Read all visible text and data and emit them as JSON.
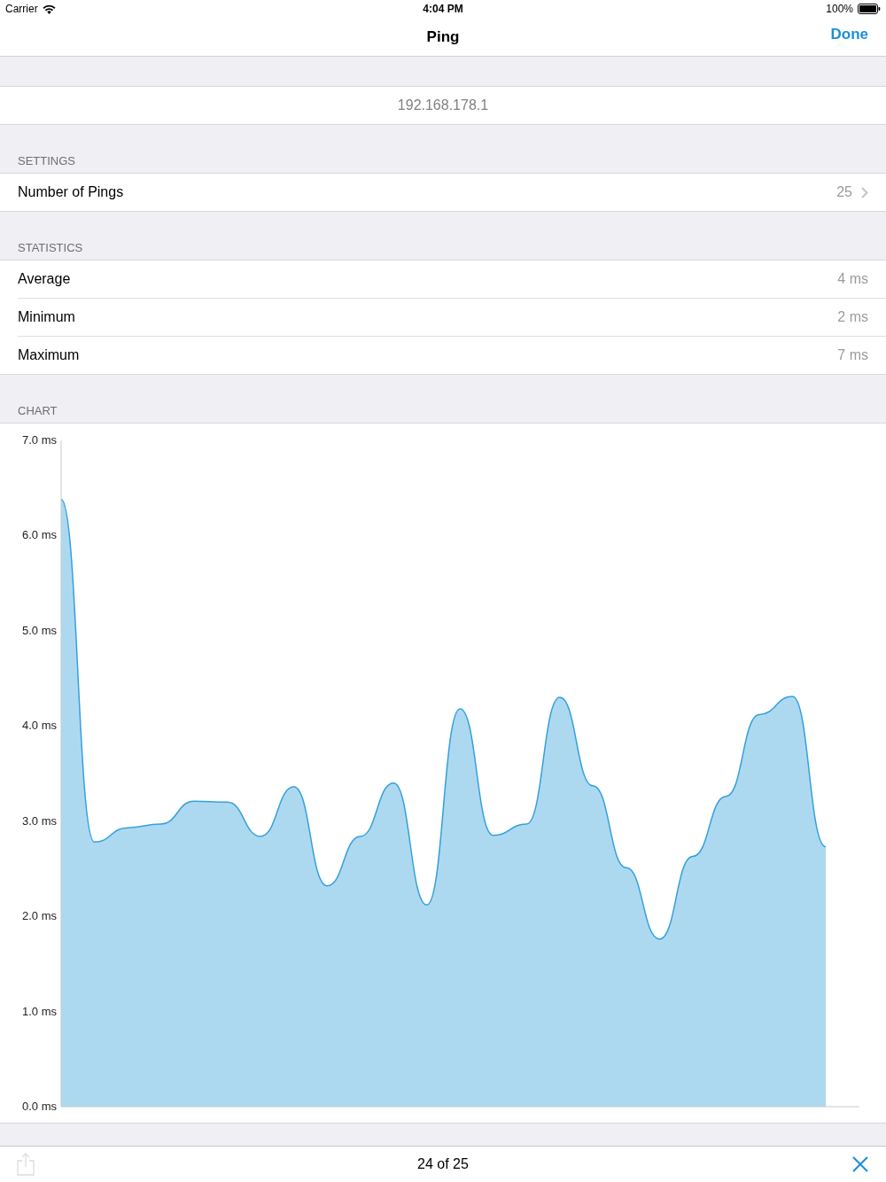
{
  "status_bar": {
    "carrier": "Carrier",
    "time": "4:04 PM",
    "battery": "100%"
  },
  "nav_bar": {
    "title": "Ping",
    "done": "Done"
  },
  "host": {
    "value": "192.168.178.1"
  },
  "sections": [
    {
      "header": "SETTINGS",
      "rows": [
        {
          "kind": "disclosure",
          "label": "Number of Pings",
          "value": "25"
        }
      ]
    },
    {
      "header": "STATISTICS",
      "rows": [
        {
          "kind": "value",
          "label": "Average",
          "value": "4 ms"
        },
        {
          "kind": "value",
          "label": "Minimum",
          "value": "2 ms"
        },
        {
          "kind": "value",
          "label": "Maximum",
          "value": "7 ms"
        }
      ]
    }
  ],
  "chart_section": {
    "header": "CHART",
    "chart_data": {
      "type": "area",
      "ylim": [
        0,
        7
      ],
      "yticks": [
        {
          "value": 0,
          "label": "0.0 ms"
        },
        {
          "value": 1,
          "label": "1.0 ms"
        },
        {
          "value": 2,
          "label": "2.0 ms"
        },
        {
          "value": 3,
          "label": "3.0 ms"
        },
        {
          "value": 4,
          "label": "4.0 ms"
        },
        {
          "value": 5,
          "label": "5.0 ms"
        },
        {
          "value": 6,
          "label": "6.0 ms"
        },
        {
          "value": 7,
          "label": "7.0 ms"
        }
      ],
      "series": [
        {
          "color": "#34a0dc",
          "values": [
            6.38,
            2.78,
            2.93,
            2.97,
            3.21,
            3.2,
            2.84,
            3.36,
            2.32,
            2.84,
            3.4,
            2.12,
            4.18,
            2.85,
            2.97,
            4.3,
            3.37,
            2.51,
            1.76,
            2.63,
            3.26,
            4.12,
            4.31,
            2.73
          ]
        }
      ]
    }
  },
  "toolbar": {
    "share": {
      "disabled": true
    },
    "status": "24 of 25"
  }
}
